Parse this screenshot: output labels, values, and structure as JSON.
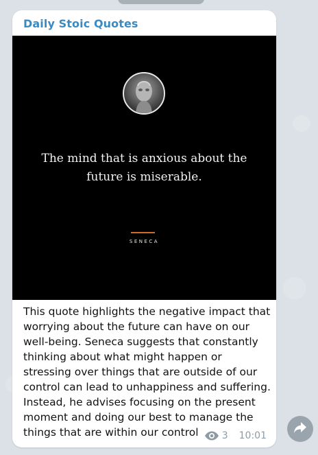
{
  "message": {
    "channel_name": "Daily Stoic Quotes",
    "image": {
      "quote": "The mind that is anxious about the future is miserable.",
      "author": "SENECA",
      "accent_color": "#d46a2a",
      "avatar_icon": "seneca-bust-avatar"
    },
    "text": "This quote highlights the negative impact that worrying about the future can have on our well-being. Seneca suggests that constantly thinking about what might happen or stressing over things that are outside of our control can lead to unhappiness and suffering. Instead, he advises focusing on the present moment and doing our best to manage the things that are within our control",
    "views": "3",
    "time": "10:01",
    "views_icon": "eye-icon"
  },
  "actions": {
    "forward_icon": "forward-arrow-icon"
  },
  "colors": {
    "channel_name": "#3a8ac4",
    "background": "#dbe1e6",
    "bubble": "#ffffff"
  }
}
